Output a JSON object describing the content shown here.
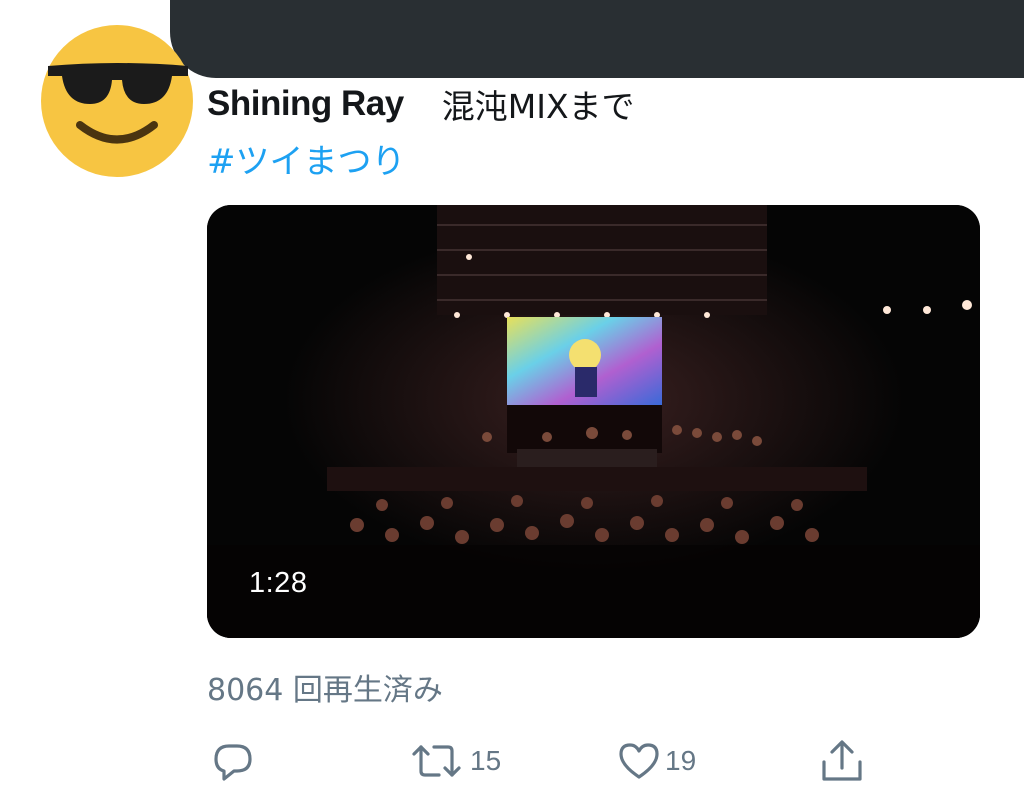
{
  "banner": {
    "color": "#292f33"
  },
  "tweet": {
    "author": {
      "display_name": "Shining Ray",
      "avatar_icon": "sunglasses-emoji-icon"
    },
    "text": "混沌MIXまで",
    "hashtag": "#ツイまつり",
    "video": {
      "duration": "1:28",
      "thumbnail": "concert-stage-photo"
    },
    "view_count": "8064 回再生済み",
    "actions": {
      "reply": {
        "icon": "reply-icon",
        "count": ""
      },
      "retweet": {
        "icon": "retweet-icon",
        "count": "15"
      },
      "like": {
        "icon": "heart-icon",
        "count": "19"
      },
      "share": {
        "icon": "share-icon"
      }
    }
  },
  "colors": {
    "link": "#1da1f2",
    "muted": "#657786",
    "text": "#14171a"
  }
}
